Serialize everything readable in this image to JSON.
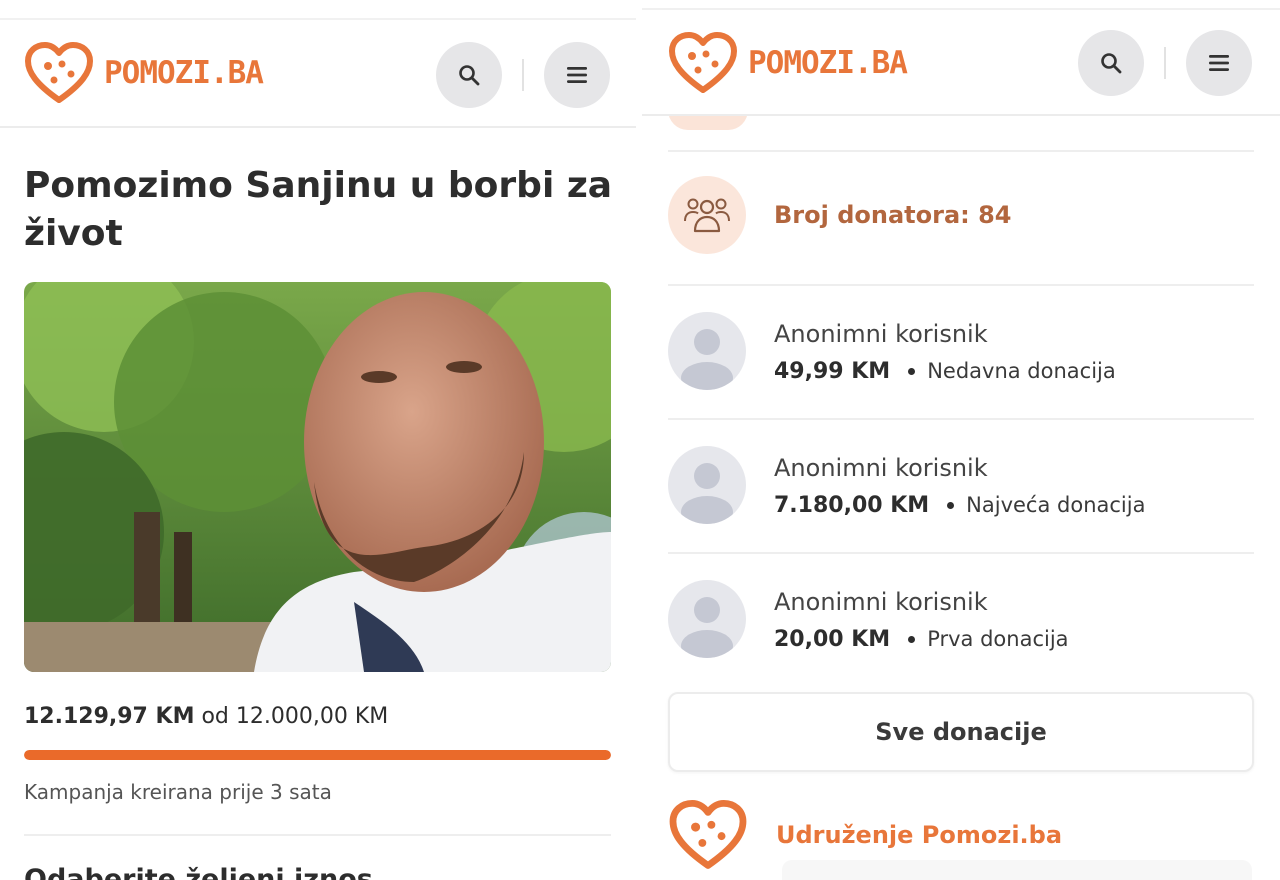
{
  "brand": {
    "name": "POMOZI.BA",
    "accent_color": "#e8763a",
    "logo_icon": "heart-logo-icon"
  },
  "header": {
    "search_icon": "search-icon",
    "menu_icon": "hamburger-menu-icon"
  },
  "campaign": {
    "title": "Pomozimo Sanjinu u borbi za život",
    "photo_alt": "campaign-photo",
    "raised": "12.129,97 KM",
    "goal_prefix": "od",
    "goal": "12.000,00 KM",
    "progress_fraction": 1.0,
    "created": "Kampanja kreirana prije 3 sata",
    "choose_amount": "Odaberite željeni iznos"
  },
  "donors": {
    "count_label": "Broj donatora: 84",
    "count_icon": "users-group-icon",
    "list": [
      {
        "name": "Anonimni korisnik",
        "amount": "49,99 KM",
        "tag": "Nedavna donacija"
      },
      {
        "name": "Anonimni korisnik",
        "amount": "7.180,00 KM",
        "tag": "Najveća donacija"
      },
      {
        "name": "Anonimni korisnik",
        "amount": "20,00 KM",
        "tag": "Prva donacija"
      }
    ],
    "all_button": "Sve donacije"
  },
  "organizer": {
    "name": "Udruženje Pomozi.ba"
  }
}
